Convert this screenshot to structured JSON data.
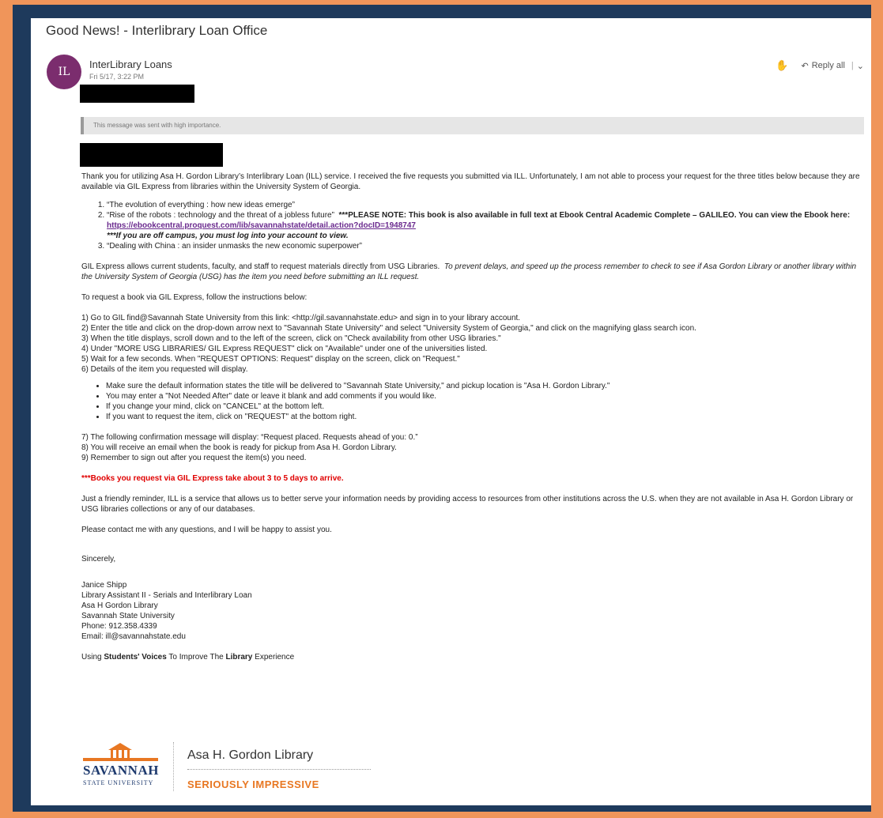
{
  "subject": "Good News! - Interlibrary Loan Office",
  "sender": {
    "initials": "IL",
    "name": "InterLibrary Loans",
    "date": "Fri 5/17, 3:22 PM"
  },
  "actions": {
    "reply_all": "Reply all",
    "like_icon": "thumbs-up-icon",
    "reply_icon": "reply-all-icon"
  },
  "importance_text": "This message was sent with high importance.",
  "body": {
    "intro": "Thank you for utilizing Asa H. Gordon Library’s Interlibrary Loan (ILL) service.  I received the five requests you submitted via ILL.  Unfortunately, I am not able to process your request for the three titles below because they are available via GIL Express from libraries within the University System of Georgia.",
    "titles": {
      "t1": "“The evolution of everything : how new ideas emerge”",
      "t2": "“Rise of the robots : technology and the threat of a jobless future”",
      "t2_note": "***PLEASE NOTE:  This book is also available in full text at Ebook Central Academic Complete – GALILEO. You can view the Ebook here:",
      "t2_link": "https://ebookcentral.proquest.com/lib/savannahstate/detail.action?docID=1948747",
      "t2_offcampus": "***If you are off campus, you must log into your account to view.",
      "t3": "“Dealing with China : an insider unmasks the new economic superpower”"
    },
    "gil_intro_plain": "GIL Express allows current students, faculty, and staff to request materials directly from USG Libraries.",
    "gil_intro_italic": "To prevent delays, and speed up the process remember to check to see if Asa Gordon Library or another library within the University System of Georgia (USG) has the item you need before submitting an ILL request.",
    "instructions_lead": "To request a book via GIL Express, follow the instructions below:",
    "steps": {
      "s1": "1)  Go to GIL find@Savannah State University from this link: <http://gil.savannahstate.edu> and sign in to your library account.",
      "s2": "2)  Enter the title and click on the drop-down arrow next to \"Savannah State University\" and select \"University System of Georgia,\" and click on the magnifying glass search icon.",
      "s3": "3)  When the title displays, scroll down and to the left of the screen, click on \"Check availability from other USG libraries.\"",
      "s4": "4)  Under \"MORE USG LIBRARIES/ GIL Express REQUEST\" click on \"Available\" under one of the universities listed.",
      "s5": "5)  Wait for a few seconds.  When \"REQUEST OPTIONS: Request\" display on the screen, click on \"Request.\"",
      "s6": "6)  Details of the item you requested will display."
    },
    "bullets": {
      "b1": "Make sure the default information states the title will be delivered to \"Savannah State University,\" and pickup location is \"Asa H. Gordon Library.\"",
      "b2": "You may enter a \"Not Needed After\" date or leave it blank and add comments if you would like.",
      "b3": "If you change your mind, click on \"CANCEL\" at the bottom left.",
      "b4": "If you want to request the item, click on \"REQUEST\" at the bottom right."
    },
    "steps_after": {
      "s7": "7) The following confirmation message will display: “Request placed. Requests ahead of you: 0.”",
      "s8": "8) You will receive an email when the book is ready for pickup from Asa H. Gordon Library.",
      "s9": "9) Remember to sign out after you request the item(s) you need."
    },
    "red_note": "***Books you request via GIL Express take about 3 to 5 days to arrive.",
    "reminder": "Just a friendly reminder, ILL is a service that allows us to better serve your information needs by providing access to resources from other institutions across the U.S. when they are not available in Asa H. Gordon Library or USG libraries collections or any of our databases.",
    "contact": "Please contact me with any questions, and I will be happy to assist you.",
    "closing": "Sincerely,",
    "signature": {
      "name": "Janice Shipp",
      "title": "Library Assistant II - Serials and Interlibrary Loan",
      "library": "Asa H Gordon Library",
      "university": "Savannah State University",
      "phone": "Phone:  912.358.4339",
      "email": "Email:  ill@savannahstate.edu"
    },
    "motto": {
      "pre": "Using ",
      "students_voices": "Students' Voices",
      "mid": " To Improve The ",
      "library": "Library",
      "post": " Experience"
    }
  },
  "logo": {
    "savannah": "SAVANNAH",
    "state_university": "STATE UNIVERSITY",
    "library_name": "Asa H. Gordon Library",
    "tagline": "SERIOUSLY IMPRESSIVE",
    "brand_orange": "#e87722",
    "brand_navy": "#1e3a6e"
  },
  "colors": {
    "frame_orange": "#f0955a",
    "frame_navy": "#1e3a5c",
    "avatar_purple": "#7b2d6e",
    "link_purple": "#6a2a8e",
    "alert_red": "#e00000"
  }
}
